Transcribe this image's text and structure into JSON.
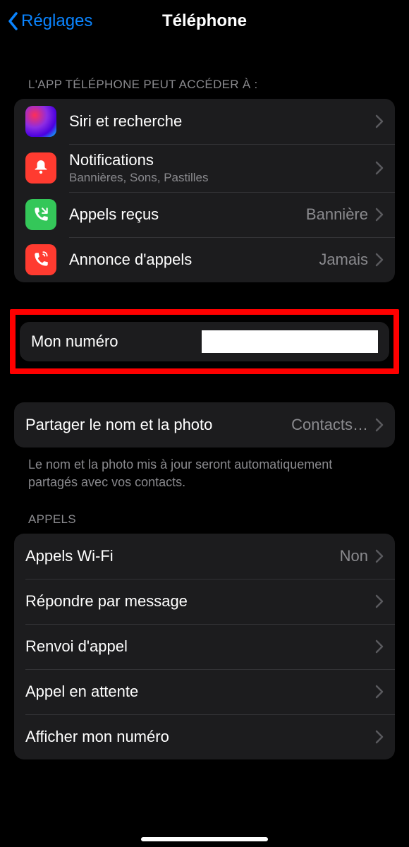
{
  "header": {
    "back_label": "Réglages",
    "title": "Téléphone"
  },
  "section_access": {
    "header": "L'APP TÉLÉPHONE PEUT ACCÉDER À :",
    "siri_label": "Siri et recherche",
    "notifications_label": "Notifications",
    "notifications_sub": "Bannières, Sons, Pastilles",
    "incoming_label": "Appels reçus",
    "incoming_value": "Bannière",
    "announce_label": "Annonce d'appels",
    "announce_value": "Jamais"
  },
  "section_number": {
    "my_number_label": "Mon numéro"
  },
  "section_share": {
    "share_label": "Partager le nom et la photo",
    "share_value": "Contacts…",
    "footer": "Le nom et la photo mis à jour seront automatiquement partagés avec vos contacts."
  },
  "section_calls": {
    "header": "APPELS",
    "wifi_label": "Appels Wi-Fi",
    "wifi_value": "Non",
    "respond_label": "Répondre par message",
    "forward_label": "Renvoi d'appel",
    "waiting_label": "Appel en attente",
    "showmy_label": "Afficher mon numéro"
  }
}
